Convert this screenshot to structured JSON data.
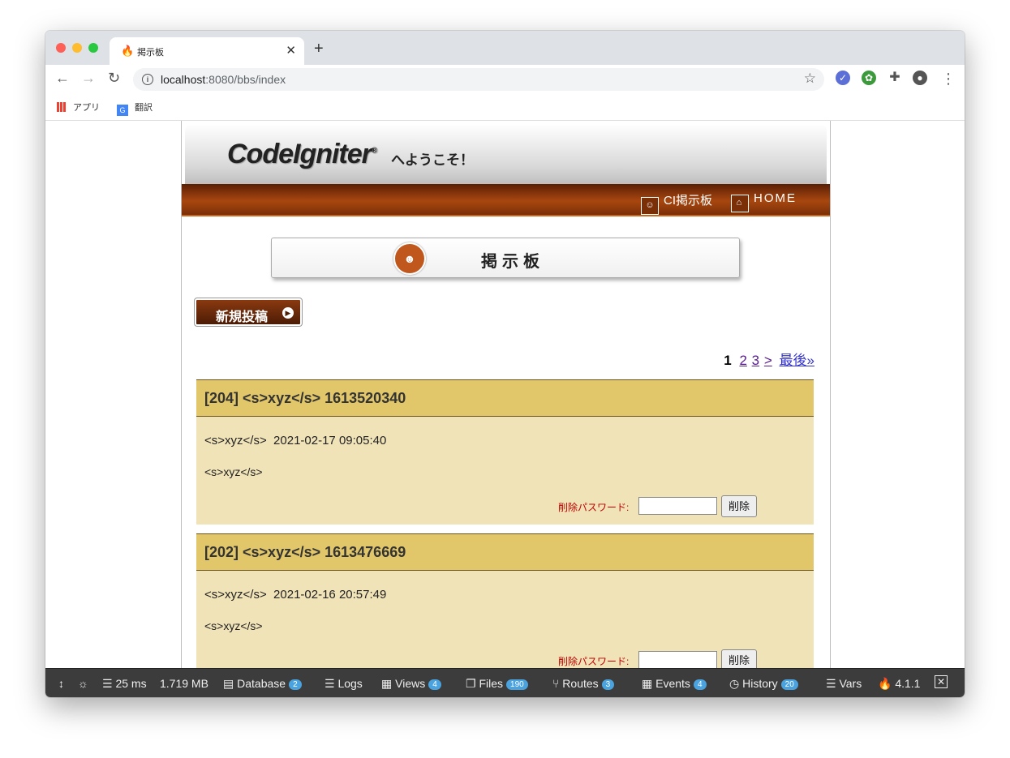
{
  "browser": {
    "tab_title": "掲示板",
    "url_host": "localhost",
    "url_rest": ":8080/bbs/index",
    "bookmarks": [
      "アプリ",
      "翻訳"
    ]
  },
  "site": {
    "logo": "CodeIgniter",
    "logo_mark": "®",
    "welcome": "へようこそ！",
    "nav": [
      "CI掲示板",
      "HOME"
    ],
    "board_title": "掲示板",
    "new_post_button": "新規投稿"
  },
  "pagination": {
    "current": "1",
    "pages": [
      "2",
      "3",
      ">"
    ],
    "last": "最後»"
  },
  "posts": [
    {
      "header": "[204] <s>xyz</s> 1613520340",
      "meta": "<s>xyz</s>  2021-02-17 09:05:40",
      "body": "<s>xyz</s>",
      "delete_label": "削除パスワード:",
      "delete_button": "削除"
    },
    {
      "header": "[202] <s>xyz</s> 1613476669",
      "meta": "<s>xyz</s>  2021-02-16 20:57:49",
      "body": "<s>xyz</s>",
      "delete_label": "削除パスワード:",
      "delete_button": "削除"
    }
  ],
  "debugbar": {
    "time": "25 ms",
    "memory": "1.719 MB",
    "items": [
      {
        "label": "Database",
        "count": "2"
      },
      {
        "label": "Logs",
        "count": ""
      },
      {
        "label": "Views",
        "count": "4"
      },
      {
        "label": "Files",
        "count": "190"
      },
      {
        "label": "Routes",
        "count": "3"
      },
      {
        "label": "Events",
        "count": "4"
      },
      {
        "label": "History",
        "count": "20"
      },
      {
        "label": "Vars",
        "count": ""
      }
    ],
    "version": "4.1.1"
  }
}
